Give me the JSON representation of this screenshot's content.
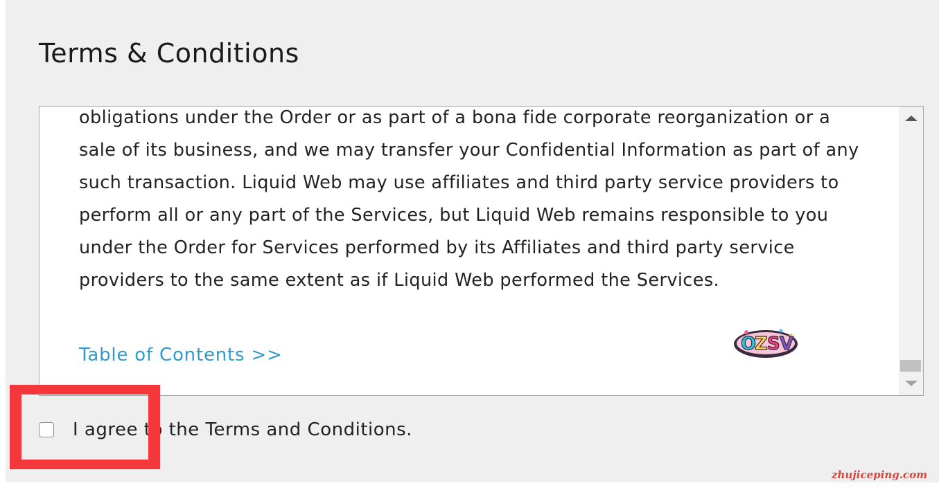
{
  "page": {
    "title": "Terms & Conditions"
  },
  "terms": {
    "body": "obligations under the Order or as part of a bona fide corporate reorganization or a sale of its business, and we may transfer your Confidential Information as part of any such transaction. Liquid Web may use affiliates and third party service providers to perform all or any part of the Services, but Liquid Web remains responsible to you under the Order for Services performed by its Affiliates and third party service providers to the same extent as if Liquid Web performed the Services.",
    "toc_link": "Table of Contents >>",
    "scroll_position_fraction": 0.95,
    "sticker_text": "OZSV"
  },
  "agree": {
    "label": "I agree to the Terms and Conditions.",
    "checked": false
  },
  "overlay": {
    "highlight_color": "#f3373b",
    "watermark": "zhujiceping.com"
  },
  "colors": {
    "panel_bg": "#efefef",
    "link": "#3399cc",
    "text": "#222222"
  }
}
